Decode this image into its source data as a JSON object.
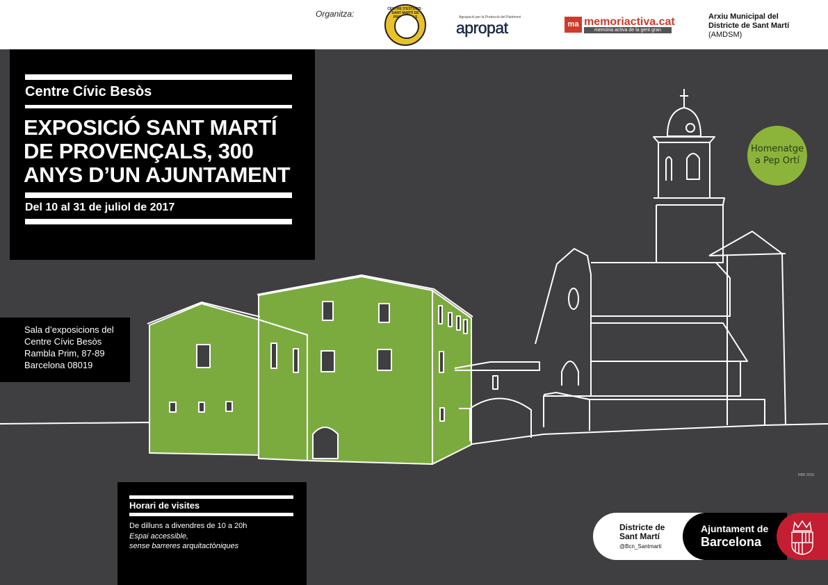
{
  "header": {
    "organitza": "Organitza:",
    "seal_text": "CENTRE D'ESTUDIS · SANT MARTÍ DE PROVENÇALS",
    "apropat_sub": "Agrupació per la Protecció del Patrimoni",
    "apropat": "apropat",
    "memoriactiva_logo": "ma",
    "memoriactiva": "memoriactiva.cat",
    "memoriactiva_sub": "memòria activa de la gent gran",
    "arxiu_line1": "Arxiu Municipal del",
    "arxiu_line2": "Districte de Sant Martí",
    "arxiu_line3": "(AMDSM)"
  },
  "title": {
    "centre": "Centre Cívic Besòs",
    "main": "EXPOSICIÓ SANT MARTÍ DE PROVENÇALS, 300 ANYS D’UN AJUNTAMENT",
    "dates": "Del 10 al 31 de juliol de 2017"
  },
  "address": {
    "line1": "Sala d’exposicions del",
    "line2": "Centre Cívic Besòs",
    "line3": "Rambla Prim,  87-89",
    "line4": "Barcelona 08019"
  },
  "hours": {
    "title": "Horari de visites",
    "line1": "De dilluns a divendres de  10 a 20h",
    "line2": "Espai accessible,",
    "line3": "sense barreres arquitactòniques"
  },
  "badge": {
    "line1": "Homenatge",
    "line2": "a Pep Ortí"
  },
  "credit": "NBR 2016",
  "footer": {
    "district_line1": "Districte de",
    "district_line2": "Sant Martí",
    "district_handle": "@Bcn_Santmarti",
    "ajuntament_line1": "Ajuntament de",
    "ajuntament_line2": "Barcelona"
  },
  "colors": {
    "background": "#3f3f41",
    "green": "#7bab3f",
    "badge_green": "#8cb43b",
    "red": "#c51d31"
  }
}
